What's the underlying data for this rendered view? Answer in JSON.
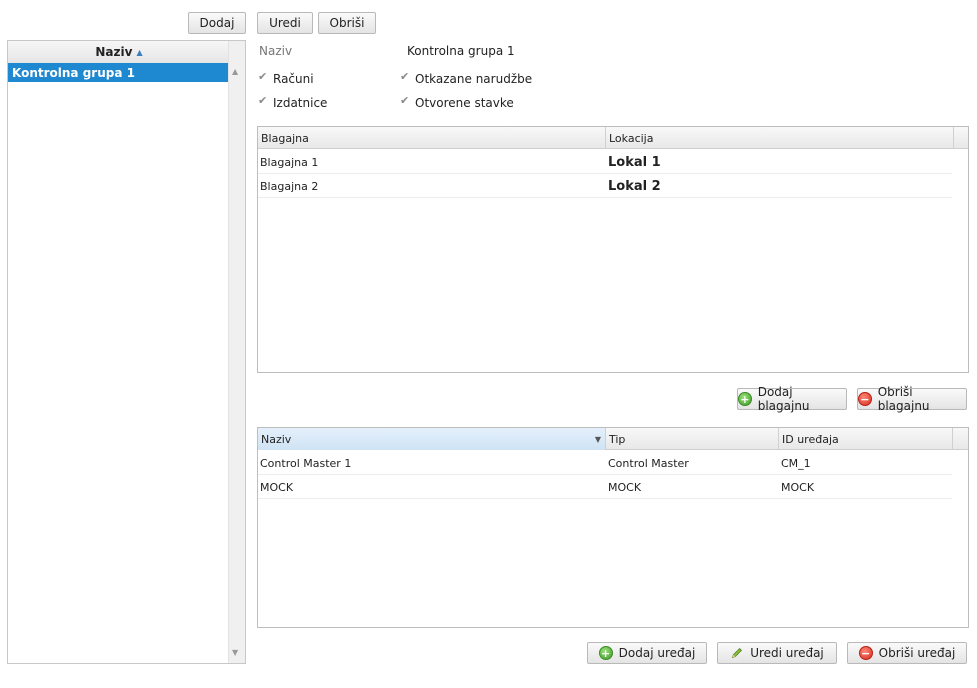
{
  "toolbar": {
    "add": "Dodaj",
    "edit": "Uredi",
    "delete": "Obriši"
  },
  "left_list": {
    "header": "Naziv",
    "items": [
      "Kontrolna grupa 1"
    ]
  },
  "detail": {
    "name_label": "Naziv",
    "name_value": "Kontrolna grupa 1",
    "checkboxes": [
      {
        "label": "Računi",
        "checked": true
      },
      {
        "label": "Otkazane narudžbe",
        "checked": true
      },
      {
        "label": "Izdatnice",
        "checked": true
      },
      {
        "label": "Otvorene stavke",
        "checked": true
      }
    ]
  },
  "registers": {
    "columns": [
      "Blagajna",
      "Lokacija"
    ],
    "rows": [
      [
        "Blagajna 1",
        "Lokal 1"
      ],
      [
        "Blagajna 2",
        "Lokal 2"
      ]
    ],
    "add_button": "Dodaj blagajnu",
    "delete_button": "Obriši blagajnu"
  },
  "devices": {
    "columns": [
      "Naziv",
      "Tip",
      "ID uređaja"
    ],
    "rows": [
      [
        "Control Master 1",
        "Control Master",
        "CM_1"
      ],
      [
        "MOCK",
        "MOCK",
        "MOCK"
      ]
    ],
    "add_button": "Dodaj uređaj",
    "edit_button": "Uredi uređaj",
    "delete_button": "Obriši uređaj"
  },
  "icons": [
    "add-icon",
    "delete-icon",
    "pencil-icon",
    "sort-ascending-icon",
    "dropdown-arrow-icon",
    "scroll-up-icon",
    "scroll-down-icon",
    "checkbox-icon"
  ],
  "colors": {
    "selection": "#1e88d0",
    "header_active": "#d6e8f7"
  }
}
